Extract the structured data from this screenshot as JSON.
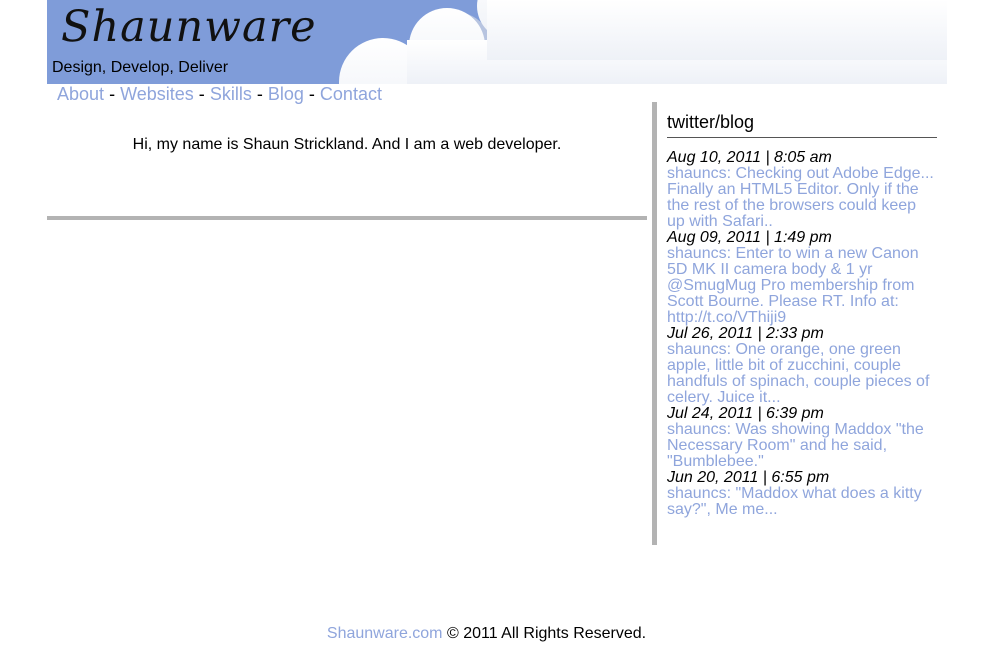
{
  "header": {
    "logo_text": "Shaunware",
    "tagline": "Design, Develop, Deliver"
  },
  "colors": {
    "sky": "#7f9cd9",
    "link": "#8fa5dc",
    "rule": "#b3b3b3"
  },
  "nav": {
    "items": [
      "About",
      "Websites",
      "Skills",
      "Blog",
      "Contact"
    ],
    "separator": "-"
  },
  "main": {
    "intro": "Hi, my name is Shaun Strickland. And I am a web developer."
  },
  "sidebar": {
    "title": "twitter/blog",
    "tweets": [
      {
        "date": "Aug 10, 2011 | 8:05 am",
        "lines": [
          "shauncs: Checking out Adobe Edge...",
          "Finally an HTML5 Editor. Only if the",
          "the rest of the browsers could keep",
          "up with Safari.."
        ]
      },
      {
        "date": "Aug 09, 2011 | 1:49 pm",
        "lines": [
          "shauncs: Enter to win a new Canon",
          "5D MK II camera body & 1 yr",
          "@SmugMug Pro membership from",
          "Scott Bourne. Please RT. Info at:",
          "http://t.co/VThiji9"
        ]
      },
      {
        "date": "Jul 26, 2011 | 2:33 pm",
        "lines": [
          "shauncs: One orange, one green",
          "apple, little bit of zucchini, couple",
          "handfuls of spinach, couple pieces of",
          "celery. Juice it..."
        ]
      },
      {
        "date": "Jul 24, 2011 | 6:39 pm",
        "lines": [
          "shauncs: Was showing Maddox \"the",
          "Necessary Room\" and he said,",
          "\"Bumblebee.\""
        ]
      },
      {
        "date": "Jun 20, 2011 | 6:55 pm",
        "lines": [
          "shauncs: \"Maddox what does a kitty",
          "say?\", Me me..."
        ]
      }
    ]
  },
  "footer": {
    "link_text": "Shaunware.com",
    "rest": " © 2011 All Rights Reserved."
  }
}
